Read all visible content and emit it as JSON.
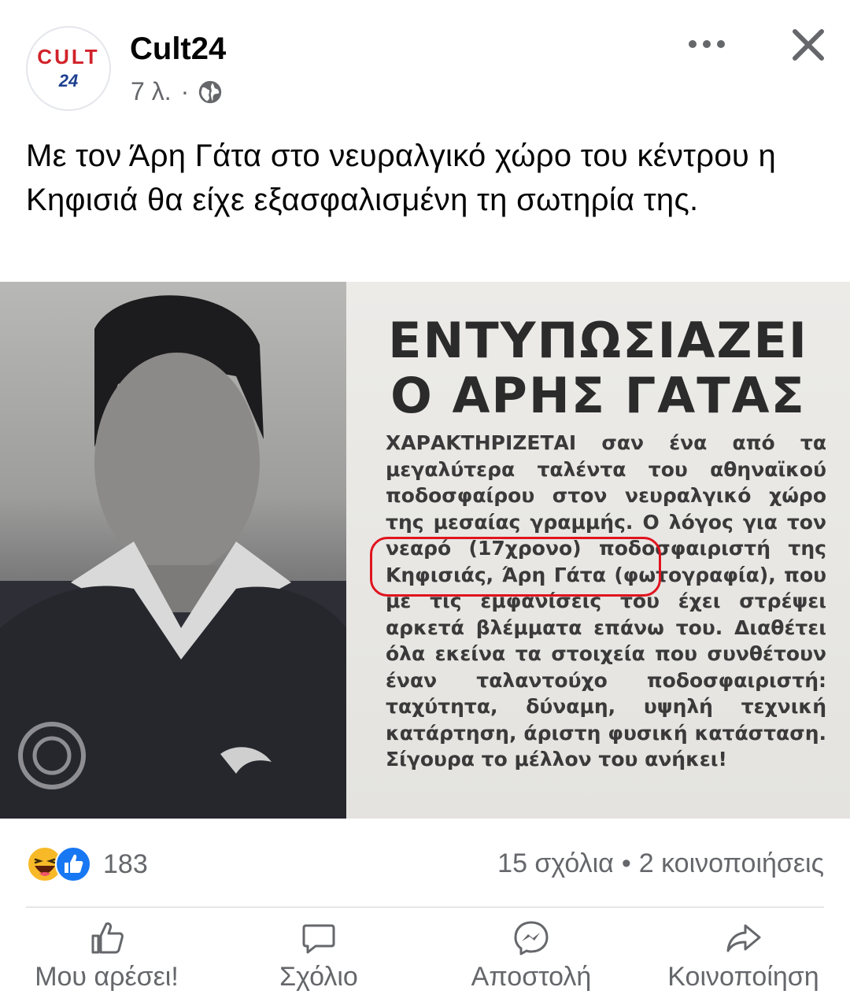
{
  "post": {
    "page_name": "Cult24",
    "avatar_text": {
      "line1": "CULT",
      "line2": "24"
    },
    "time": "7 λ.",
    "separator": "·",
    "privacy_icon": "globe-icon",
    "caption": "Με τον Άρη Γάτα στο νευραλγικό χώρο του κέντρου η Κηφισιά θα είχε εξασφαλισμένη τη σωτηρία της."
  },
  "header_actions": {
    "more_icon": "more-icon",
    "close_icon": "close-icon"
  },
  "clipping": {
    "headline_line1": "ΕΝΤΥΠΩΣΙΑΖΕΙ",
    "headline_line2": "Ο ΑΡΗΣ ΓΑΤΑΣ",
    "body": "ΧΑΡΑΚΤΗΡΙΖΕΤΑΙ σαν ένα από τα μεγαλύτερα ταλέντα του αθηναϊκού ποδοσφαίρου στον νευραλγικό χώρο της μεσαίας γραμμής. Ο λόγος για τον νεαρό (17χρονο) ποδοσφαιριστή της Κηφισιάς, Άρη Γάτα (φωτογραφία), που με τις εμφανίσεις του έχει στρέψει αρκετά βλέμματα επάνω του. Διαθέτει όλα εκείνα τα στοιχεία που συνθέτουν έναν ταλαντούχο ποδοσφαιριστή: ταχύτητα, δύναμη, υψηλή τεχνική κατάρτηση, άριστη φυσική κατάσταση. Σίγουρα το μέλλον του ανήκει!"
  },
  "engagement": {
    "reaction_icons": [
      "haha-icon",
      "like-icon"
    ],
    "reaction_count": "183",
    "comments": "15 σχόλια",
    "dot": "•",
    "shares": "2 κοινοποιήσεις"
  },
  "actions": [
    {
      "icon": "like-icon",
      "label": "Μου αρέσει!"
    },
    {
      "icon": "comment-icon",
      "label": "Σχόλιο"
    },
    {
      "icon": "messenger-icon",
      "label": "Αποστολή"
    },
    {
      "icon": "share-icon",
      "label": "Κοινοποίηση"
    }
  ],
  "colors": {
    "text": "#050505",
    "secondary": "#65676b",
    "like_blue": "#1877f2",
    "haha_yellow": "#f7b928",
    "highlight_red": "#e0141e"
  }
}
